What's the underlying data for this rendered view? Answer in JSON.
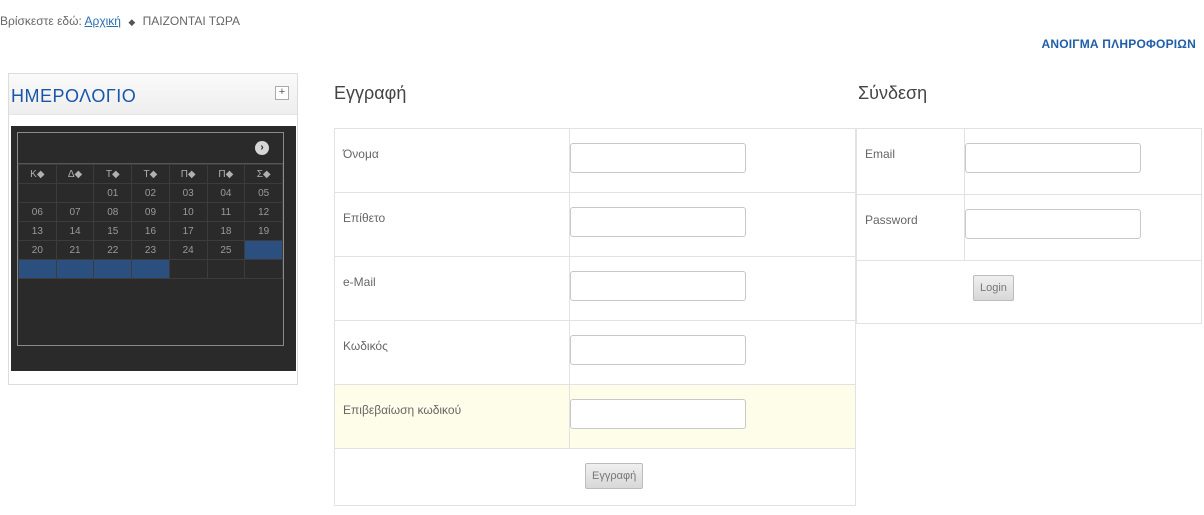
{
  "breadcrumb": {
    "prefix": "Βρίσκεστε εδώ:",
    "home": "Αρχική",
    "current": "ΠΑΙΖΟΝΤΑΙ ΤΩΡΑ"
  },
  "info_link": "ΑΝΟΙΓΜΑ ΠΛΗΡΟΦΟΡΙΩΝ",
  "calendar": {
    "title": "ΗΜΕΡΟΛΟΓΙΟ",
    "toggle": "+",
    "weekdays": [
      "Κ◆",
      "Δ◆",
      "Τ◆",
      "Τ◆",
      "Π◆",
      "Π◆",
      "Σ◆"
    ],
    "weeks": [
      [
        "",
        "",
        "01",
        "02",
        "03",
        "04",
        "05"
      ],
      [
        "06",
        "07",
        "08",
        "09",
        "10",
        "11",
        "12"
      ],
      [
        "13",
        "14",
        "15",
        "16",
        "17",
        "18",
        "19"
      ],
      [
        "20",
        "21",
        "22",
        "23",
        "24",
        "25",
        ""
      ],
      [
        "",
        "",
        "",
        "",
        "",
        "",
        ""
      ]
    ]
  },
  "register": {
    "title": "Εγγραφή",
    "fields": [
      {
        "label": "Όνομα"
      },
      {
        "label": "Επίθετο"
      },
      {
        "label": "e-Mail"
      },
      {
        "label": "Κωδικός"
      },
      {
        "label": "Επιβεβαίωση κωδικού"
      }
    ],
    "button": "Εγγραφή"
  },
  "login": {
    "title": "Σύνδεση",
    "fields": [
      {
        "label": "Email"
      },
      {
        "label": "Password"
      }
    ],
    "button": "Login"
  }
}
